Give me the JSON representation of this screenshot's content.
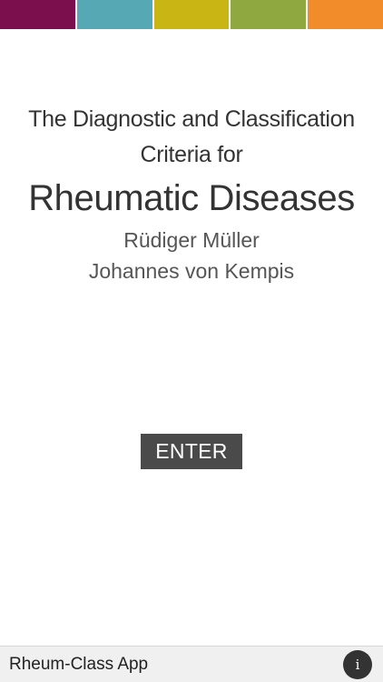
{
  "header": {
    "color_stripes": [
      {
        "name": "plum",
        "color": "#7b0f4e"
      },
      {
        "name": "teal",
        "color": "#55a8b4"
      },
      {
        "name": "mustard",
        "color": "#c9b614"
      },
      {
        "name": "olive",
        "color": "#8fa83f"
      },
      {
        "name": "orange",
        "color": "#f28c2a"
      }
    ]
  },
  "title": {
    "line1": "The Diagnostic and Classification",
    "line2": "Criteria for",
    "line3": "Rheumatic Diseases"
  },
  "authors": [
    "Rüdiger Müller",
    "Johannes von Kempis"
  ],
  "enter_button": {
    "label": "ENTER"
  },
  "footer": {
    "app_name": "Rheum-Class App",
    "info_icon": "info-icon",
    "info_label": "i"
  }
}
